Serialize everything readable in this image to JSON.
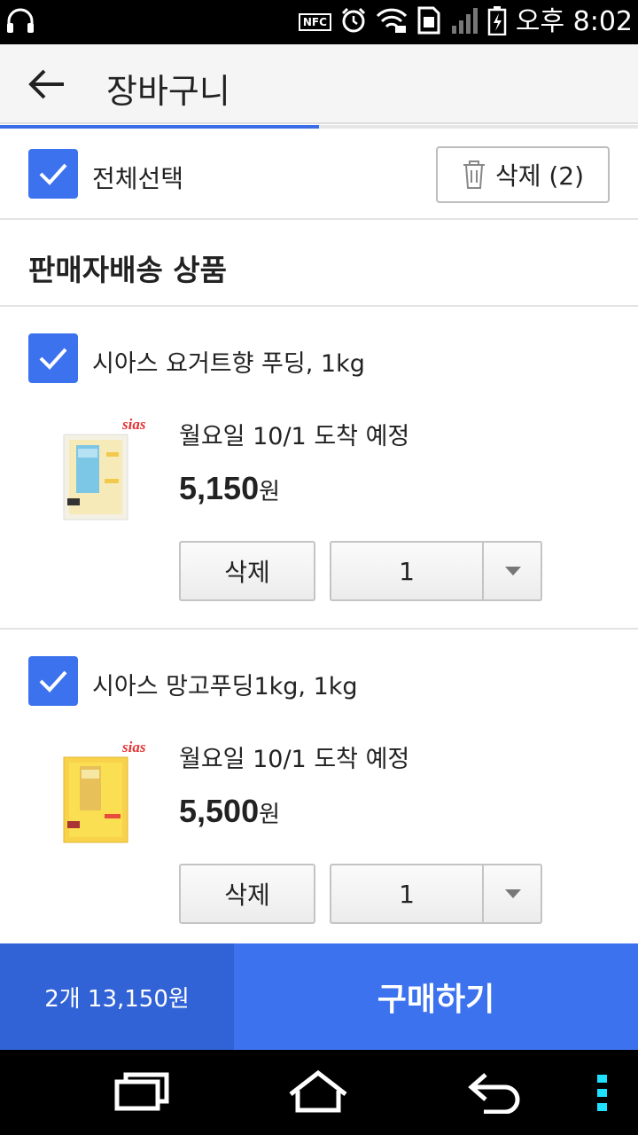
{
  "status_bar": {
    "nfc": "NFC",
    "time": "오후 8:02",
    "icons": [
      "headset-icon",
      "nfc-icon",
      "alarm-icon",
      "wifi-icon",
      "sim-icon",
      "signal-icon",
      "battery-icon"
    ]
  },
  "header": {
    "back_icon": "arrow-left-icon",
    "title": "장바구니",
    "progress": 0.5
  },
  "select_all": {
    "checked": true,
    "label": "전체선택",
    "delete_button": "삭제 (2)"
  },
  "section": {
    "title": "판매자배송 상품"
  },
  "items": [
    {
      "checked": true,
      "name": "시아스 요거트향 푸딩, 1kg",
      "brand": "sias",
      "delivery": "월요일 10/1 도착 예정",
      "price": "5,150",
      "currency": "원",
      "delete_label": "삭제",
      "quantity": "1"
    },
    {
      "checked": true,
      "name": "시아스 망고푸딩1kg, 1kg",
      "brand": "sias",
      "delivery": "월요일 10/1 도착 예정",
      "price": "5,500",
      "currency": "원",
      "delete_label": "삭제",
      "quantity": "1"
    }
  ],
  "bottom_bar": {
    "summary": "2개 13,150원",
    "buy_label": "구매하기"
  },
  "nav_bar": {
    "icons": [
      "recent-apps-icon",
      "home-icon",
      "back-icon",
      "menu-icon"
    ]
  },
  "colors": {
    "accent": "#3d72ef",
    "accent_dark": "#3263d6",
    "status_bar": "#000000"
  }
}
